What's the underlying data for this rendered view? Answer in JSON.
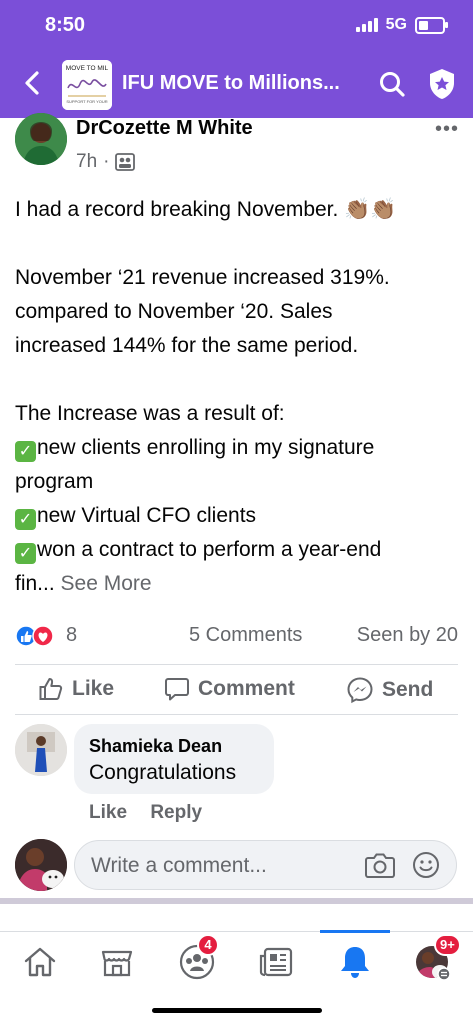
{
  "status_bar": {
    "time": "8:50",
    "network": "5G"
  },
  "group": {
    "title": "IFU MOVE to Millions...",
    "logo_text": "MOVE TO MIL"
  },
  "post": {
    "author": "DrCozette M White",
    "time": "7h",
    "lines": {
      "l1": "I had a record breaking November. 👏🏽👏🏽",
      "l2": "November ‘21 revenue increased 319%.",
      "l3": "compared to November ‘20.  Sales",
      "l4": "increased 144% for the same period.",
      "l5": "The Increase was a result of:",
      "l6": "new clients enrolling in my signature",
      "l7": "program",
      "l8": "new Virtual CFO clients",
      "l9": "won a contract to perform a year-end",
      "l10": "fin..."
    },
    "see_more": "See More",
    "reaction_count": "8",
    "comments_count": "5 Comments",
    "seen_by": "Seen by 20"
  },
  "actions": {
    "like": "Like",
    "comment": "Comment",
    "send": "Send"
  },
  "comment": {
    "name": "Shamieka Dean",
    "text": "Congratulations",
    "like": "Like",
    "reply": "Reply"
  },
  "composer": {
    "placeholder": "Write a comment..."
  },
  "tabbar": {
    "groups_badge": "4",
    "profile_badge": "9+"
  },
  "colors": {
    "header": "#7b4fd8",
    "accent": "#1877f2",
    "badge": "#e41e3f",
    "check": "#5bb543"
  }
}
